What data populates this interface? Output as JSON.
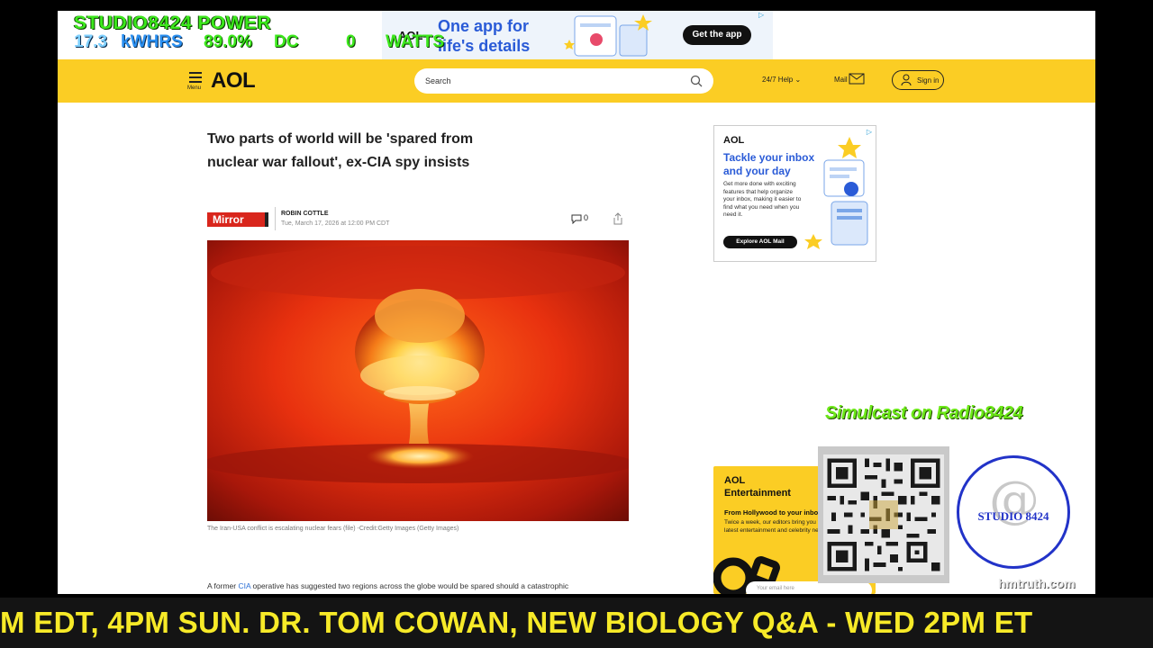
{
  "top_ad": {
    "brand": "AOL",
    "headline": "One app for",
    "subline": "life's details",
    "cta": "Get the app",
    "choice_icon": "ad-choices-icon"
  },
  "header": {
    "menu_label": "Menu",
    "logo": "AOL",
    "search_placeholder": "Search",
    "help_label": "24/7 Help",
    "mail_label": "Mail",
    "signin_label": "Sign in",
    "bg_color": "#fbcd24"
  },
  "article": {
    "title": "Two parts of world will be 'spared from nuclear war fallout', ex-CIA spy insists",
    "source": "Mirror",
    "author": "ROBIN COTTLE",
    "date": "Tue, March 17, 2026 at 12:00 PM CDT",
    "comments_count": "0",
    "caption": "The Iran-USA conflict is escalating nuclear fears (file) -Credit:Getty Images (Getty Images)",
    "body_start": "A former ",
    "body_link": "CIA",
    "body_rest": " operative has suggested two regions across the globe would be spared should a catastrophic"
  },
  "side_ad": {
    "brand": "AOL",
    "headline": "Tackle your inbox and your day",
    "copy": "Get more done with exciting features that help organize your inbox, making it easier to find what you need when you need it.",
    "cta": "Explore AOL Mail"
  },
  "ent_ad": {
    "brand": "AOL",
    "name": "Entertainment",
    "headline": "From Hollywood to your inbox",
    "copy": "Twice a week, our editors bring you the latest entertainment and celebrity news.",
    "email_placeholder": "Your email here"
  },
  "overlay": {
    "power_title": "STUDIO8424 POWER",
    "kwh_value": "17.3",
    "kwh_label": "kWHRS",
    "percent_value": "89.0%",
    "dc_label": "DC",
    "watts_value": "0",
    "watts_label": "WATTS",
    "simulcast": "Simulcast on Radio8424",
    "station_logo_text": "STUDIO 8424",
    "watermark": "hmtruth.com",
    "ticker": "M EDT, 4PM SUN. DR. TOM COWAN, NEW BIOLOGY Q&A - WED 2PM ET"
  }
}
